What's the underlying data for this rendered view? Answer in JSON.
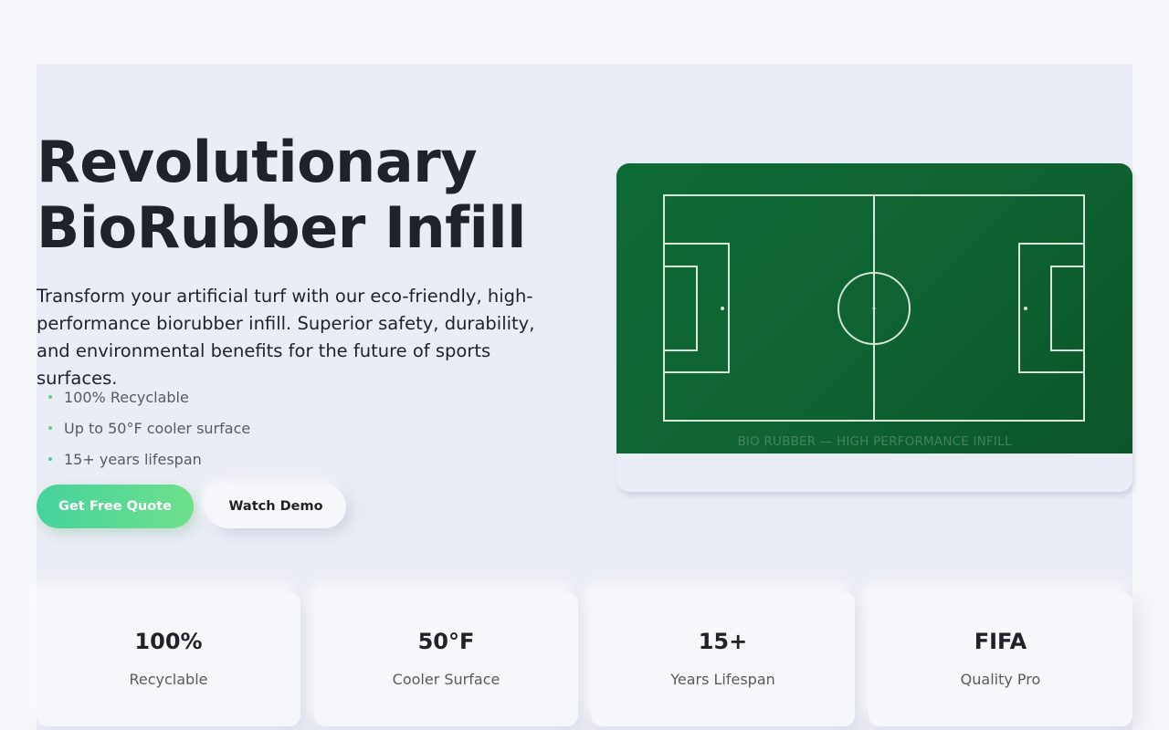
{
  "hero": {
    "title_line1": "Revolutionary",
    "title_line2": "BioRubber Infill",
    "subtitle": "Transform your artificial turf with our eco-friendly, high-performance biorubber infill. Superior safety, durability, and environmental benefits for the future of sports surfaces.",
    "features": [
      "100% Recyclable",
      "Up to 50°F cooler surface",
      "15+ years lifespan"
    ],
    "primary_button": "Get Free Quote",
    "secondary_button": "Watch Demo"
  },
  "field_image": {
    "caption": "BIO RUBBER — HIGH PERFORMANCE INFILL"
  },
  "stats": [
    {
      "value": "100%",
      "label": "Recyclable"
    },
    {
      "value": "50°F",
      "label": "Cooler Surface"
    },
    {
      "value": "15+",
      "label": "Years Lifespan"
    },
    {
      "value": "FIFA",
      "label": "Quality Pro"
    }
  ],
  "colors": {
    "accent_green": "#4fd18b",
    "field_green": "#0e6a35",
    "background": "#f6f7fb"
  }
}
